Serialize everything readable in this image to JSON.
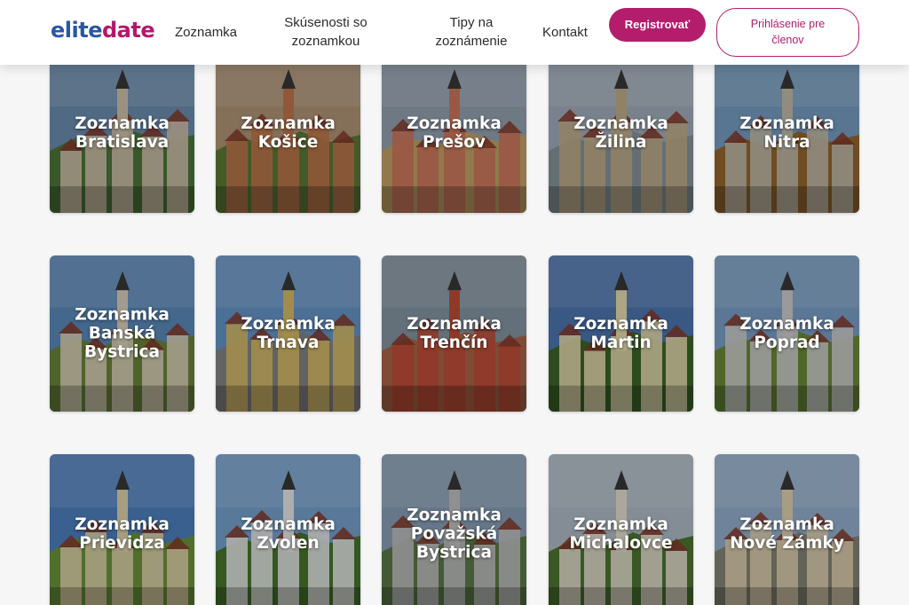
{
  "brand": {
    "logo_part1": "elite",
    "logo_part2": "date"
  },
  "nav": {
    "zoznamka": "Zoznamka",
    "skusenosti_line1": "Skúsenosti so",
    "skusenosti_line2": "zoznamkou",
    "tipy_line1": "Tipy na",
    "tipy_line2": "zoznámenie",
    "kontakt": "Kontakt"
  },
  "buttons": {
    "register": "Registrovať",
    "login": "Prihlásenie pre členov"
  },
  "colors": {
    "brand_blue": "#2a56a6",
    "brand_magenta": "#b31d6c"
  },
  "cities": [
    {
      "label": "Zoznamka Bratislava",
      "sky": "#6f93b8",
      "ground": "#4f7a3c",
      "accent": "#d8c9b0"
    },
    {
      "label": "Zoznamka Košice",
      "sky": "#b89a7a",
      "ground": "#5f7f3a",
      "accent": "#c87a4f"
    },
    {
      "label": "Zoznamka Prešov",
      "sky": "#9aa8b8",
      "ground": "#c9a86a",
      "accent": "#d67a5f"
    },
    {
      "label": "Zoznamka Žilina",
      "sky": "#a8b4c2",
      "ground": "#8c9aa0",
      "accent": "#c8b48e"
    },
    {
      "label": "Zoznamka Nitra",
      "sky": "#7aa3c9",
      "ground": "#9a6a2f",
      "accent": "#c9c2b0"
    },
    {
      "label": "Zoznamka Banská Bystrica",
      "sky": "#5f8fc2",
      "ground": "#6f8a3c",
      "accent": "#e2d8c0"
    },
    {
      "label": "Zoznamka Trnava",
      "sky": "#6a9ad0",
      "ground": "#8a8a8a",
      "accent": "#e0c36a"
    },
    {
      "label": "Zoznamka Trenčín",
      "sky": "#8a9aa8",
      "ground": "#b0684a",
      "accent": "#c94f3a"
    },
    {
      "label": "Zoznamka Martin",
      "sky": "#4f7ab8",
      "ground": "#3f6a2a",
      "accent": "#f0e6b8"
    },
    {
      "label": "Zoznamka Poprad",
      "sky": "#7fa6d0",
      "ground": "#6f8f3a",
      "accent": "#d6d6d6"
    },
    {
      "label": "Zoznamka Prievidza",
      "sky": "#4f86c6",
      "ground": "#6f9a3c",
      "accent": "#e8dcb0"
    },
    {
      "label": "Zoznamka Zvolen",
      "sky": "#7aa8d6",
      "ground": "#4a7a2f",
      "accent": "#f2f2f2"
    },
    {
      "label": "Zoznamka Považská Bystrica",
      "sky": "#8ea6be",
      "ground": "#5f7f4a",
      "accent": "#c8c8c8"
    },
    {
      "label": "Zoznamka Michalovce",
      "sky": "#b8c4cf",
      "ground": "#4f7a34",
      "accent": "#efe8d8"
    },
    {
      "label": "Zoznamka Nové Zámky",
      "sky": "#9ab8d6",
      "ground": "#8a8a7a",
      "accent": "#e8d8b8"
    }
  ]
}
